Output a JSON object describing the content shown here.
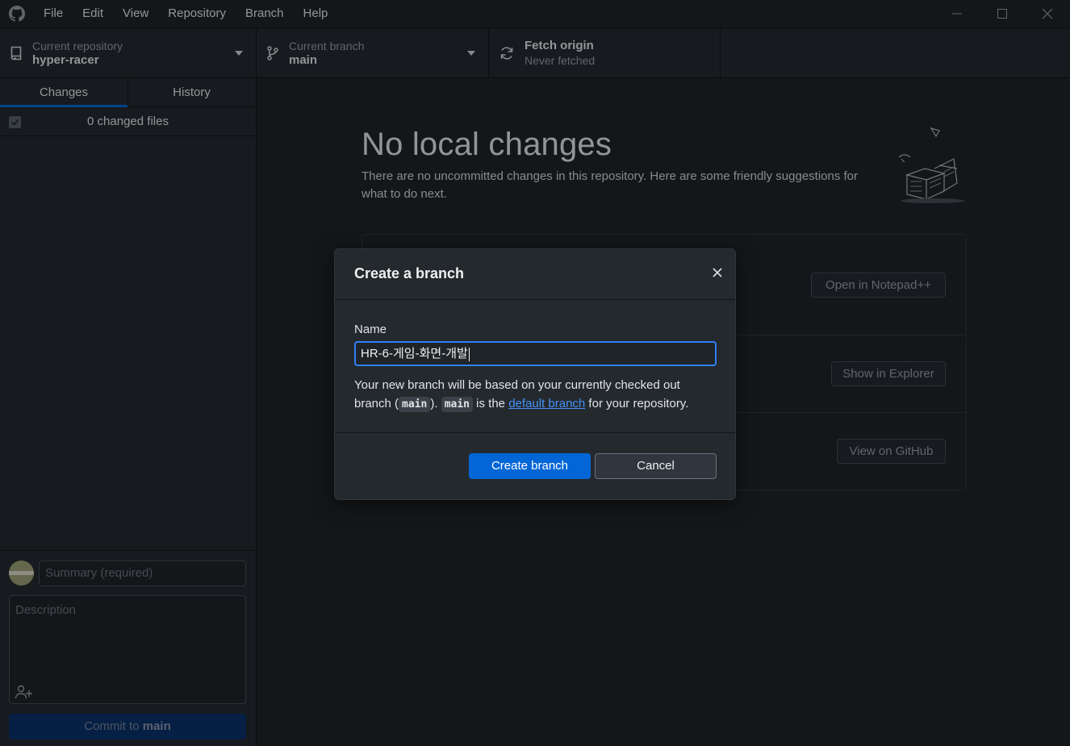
{
  "menu": {
    "items": [
      "File",
      "Edit",
      "View",
      "Repository",
      "Branch",
      "Help"
    ]
  },
  "toolbar": {
    "repository": {
      "label": "Current repository",
      "value": "hyper-racer"
    },
    "branch": {
      "label": "Current branch",
      "value": "main"
    },
    "fetch": {
      "label": "Fetch origin",
      "status": "Never fetched"
    }
  },
  "sidebar": {
    "tabs": [
      "Changes",
      "History"
    ],
    "changed_files": "0 changed files",
    "summary_placeholder": "Summary (required)",
    "description_placeholder": "Description",
    "commit_prefix": "Commit to",
    "commit_branch": "main"
  },
  "main": {
    "title": "No local changes",
    "description": "There are no uncommitted changes in this repository. Here are some friendly suggestions for what to do next.",
    "suggestions": [
      {
        "button": "Open in Notepad++"
      },
      {
        "button": "Show in Explorer"
      },
      {
        "button": "View on GitHub"
      }
    ]
  },
  "dialog": {
    "title": "Create a branch",
    "name_label": "Name",
    "name_value": "HR-6-게임-화면-개발",
    "help_1": "Your new branch will be based on your currently checked out branch (",
    "help_code_1": "main",
    "help_2": "). ",
    "help_code_2": "main",
    "help_3": " is the ",
    "help_link": "default branch",
    "help_4": " for your repository.",
    "create_button": "Create branch",
    "cancel_button": "Cancel"
  }
}
